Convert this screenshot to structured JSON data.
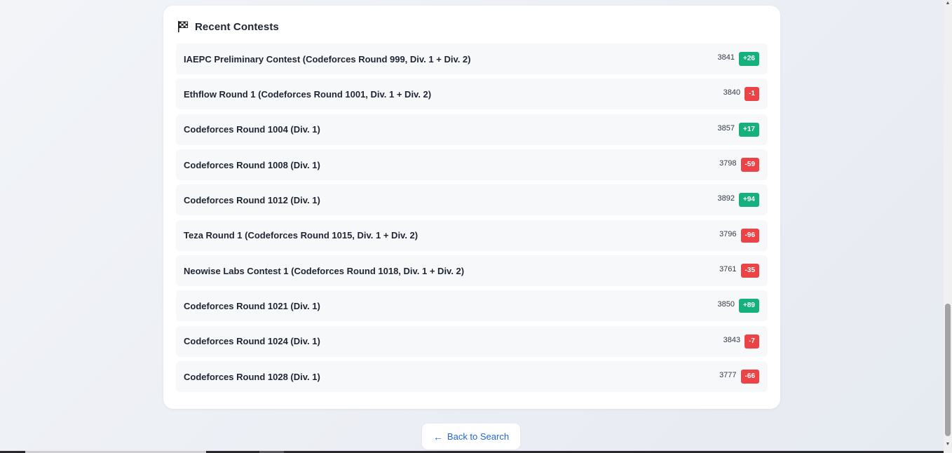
{
  "section": {
    "title": "Recent Contests",
    "icon": "flag-icon"
  },
  "contests": [
    {
      "name": "IAEPC Preliminary Contest (Codeforces Round 999, Div. 1 + Div. 2)",
      "rating": "3841",
      "delta": "+26",
      "positive": true
    },
    {
      "name": "Ethflow Round 1 (Codeforces Round 1001, Div. 1 + Div. 2)",
      "rating": "3840",
      "delta": "-1",
      "positive": false
    },
    {
      "name": "Codeforces Round 1004 (Div. 1)",
      "rating": "3857",
      "delta": "+17",
      "positive": true
    },
    {
      "name": "Codeforces Round 1008 (Div. 1)",
      "rating": "3798",
      "delta": "-59",
      "positive": false
    },
    {
      "name": "Codeforces Round 1012 (Div. 1)",
      "rating": "3892",
      "delta": "+94",
      "positive": true
    },
    {
      "name": "Teza Round 1 (Codeforces Round 1015, Div. 1 + Div. 2)",
      "rating": "3796",
      "delta": "-96",
      "positive": false
    },
    {
      "name": "Neowise Labs Contest 1 (Codeforces Round 1018, Div. 1 + Div. 2)",
      "rating": "3761",
      "delta": "-35",
      "positive": false
    },
    {
      "name": "Codeforces Round 1021 (Div. 1)",
      "rating": "3850",
      "delta": "+89",
      "positive": true
    },
    {
      "name": "Codeforces Round 1024 (Div. 1)",
      "rating": "3843",
      "delta": "-7",
      "positive": false
    },
    {
      "name": "Codeforces Round 1028 (Div. 1)",
      "rating": "3777",
      "delta": "-66",
      "positive": false
    }
  ],
  "back_button": {
    "arrow": "←",
    "label": "Back to Search"
  },
  "colors": {
    "positive": "#16b07d",
    "negative": "#ec4347",
    "link": "#2166e0"
  }
}
